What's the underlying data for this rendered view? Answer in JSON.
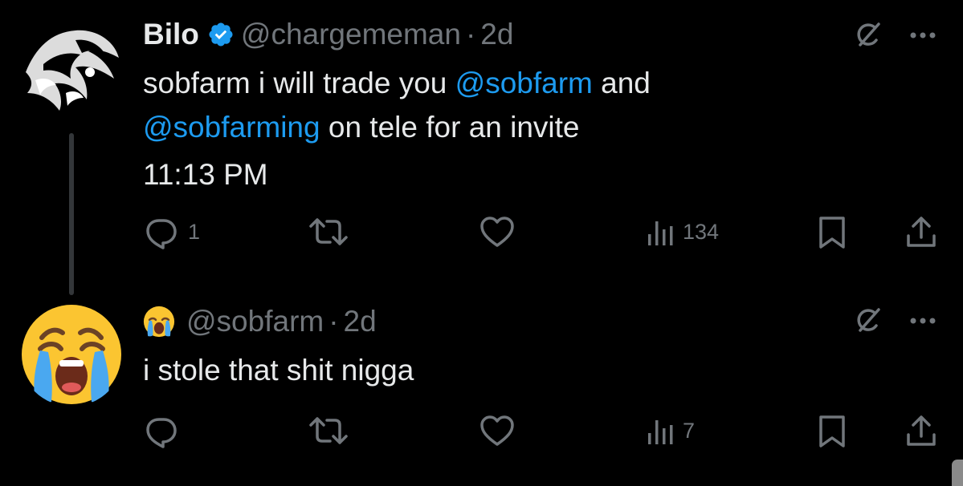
{
  "tweets": [
    {
      "display_name": "Bilo",
      "verified": true,
      "handle": "@chargememan",
      "separator": "·",
      "time_ago": "2d",
      "text_parts": [
        "sobfarm i will trade you ",
        "@sobfarm",
        " and",
        "@sobfarming",
        " on tele for an invite"
      ],
      "timestamp": "11:13 PM",
      "replies": "1",
      "views": "134",
      "icons": [
        "grok-icon",
        "more-icon",
        "reply-icon",
        "retweet-icon",
        "like-icon",
        "views-icon",
        "bookmark-icon",
        "share-icon"
      ]
    },
    {
      "display_name_emoji": "loudly-crying-face",
      "handle": "@sobfarm",
      "separator": "·",
      "time_ago": "2d",
      "text": "i stole that shit nigga",
      "replies": "",
      "views": "7",
      "icons": [
        "grok-icon",
        "more-icon",
        "reply-icon",
        "retweet-icon",
        "like-icon",
        "views-icon",
        "bookmark-icon",
        "share-icon"
      ]
    }
  ],
  "colors": {
    "background": "#000000",
    "text": "#e7e9ea",
    "secondary": "#71767b",
    "link": "#1d9bf0",
    "verified": "#1d9bf0",
    "thread_line": "#333639"
  }
}
